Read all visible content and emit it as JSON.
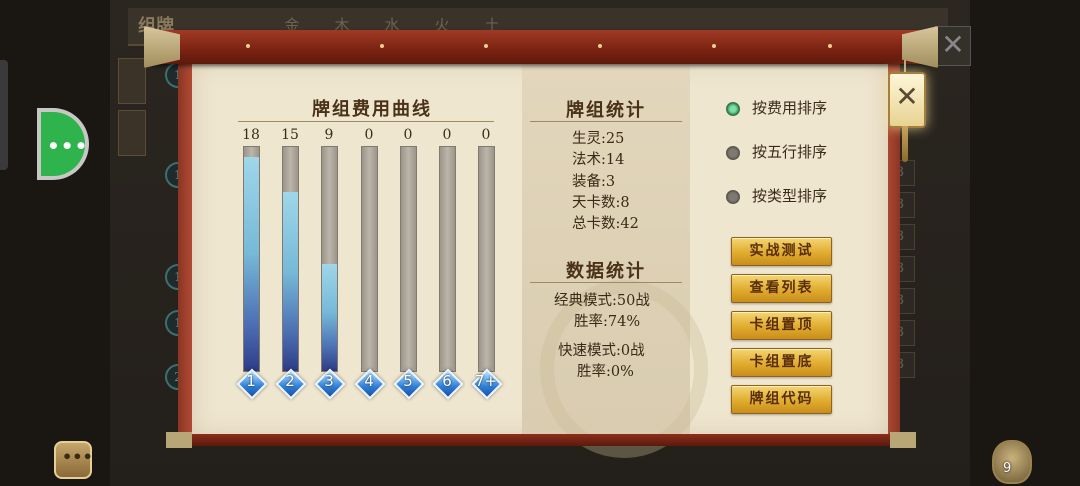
{
  "background": {
    "header_title": "组牌",
    "tabs": [
      "金",
      "木",
      "水",
      "火",
      "土"
    ],
    "left_numbers": [
      "1",
      "1",
      "1",
      "1",
      "2"
    ],
    "right_numbers": [
      "3",
      "3",
      "3",
      "3",
      "3",
      "3",
      "3"
    ],
    "bag_count": "9"
  },
  "chart_data": {
    "type": "bar",
    "title": "牌组费用曲线",
    "categories": [
      "1",
      "2",
      "3",
      "4",
      "5",
      "6",
      "7+"
    ],
    "values": [
      18,
      15,
      9,
      0,
      0,
      0,
      0
    ],
    "ylim": [
      0,
      18.8
    ],
    "colors": {
      "fill_top": "#9fd6ea",
      "fill_bottom": "#2d3c86",
      "track": "#aaa397"
    }
  },
  "deck_stats": {
    "title": "牌组统计",
    "lines": [
      "生灵:25",
      "法术:14",
      "装备:3",
      "天卡数:8",
      "总卡数:42"
    ]
  },
  "data_stats": {
    "title": "数据统计",
    "lines": [
      "经典模式:50战",
      "胜率:74%",
      "快速模式:0战",
      "胜率:0%"
    ]
  },
  "sort_options": [
    {
      "label": "按费用排序",
      "selected": true
    },
    {
      "label": "按五行排序",
      "selected": false
    },
    {
      "label": "按类型排序",
      "selected": false
    }
  ],
  "actions": [
    "实战测试",
    "查看列表",
    "卡组置顶",
    "卡组置底",
    "牌组代码"
  ],
  "colors": {
    "button_gold": "#e0ac2e",
    "selected_radio": "#2e9d5e",
    "paper": "#efe6d0",
    "roller": "#7a2212"
  }
}
